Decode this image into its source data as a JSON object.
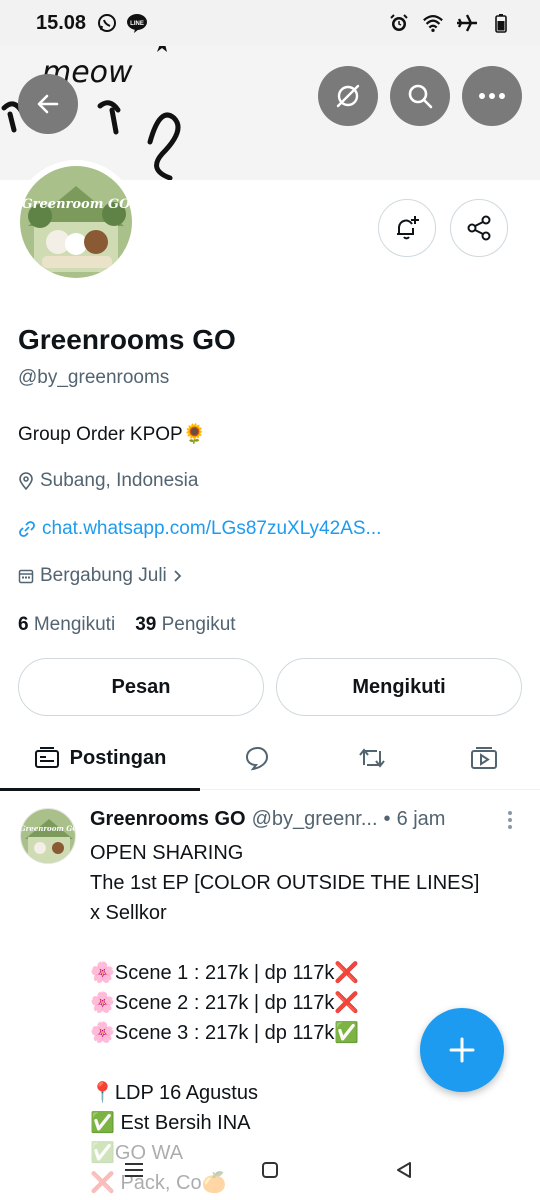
{
  "status_bar": {
    "time": "15.08",
    "left_icons": [
      "whatsapp-icon",
      "line-icon"
    ],
    "right_icons": [
      "alarm-icon",
      "wifi-icon",
      "airplane-icon",
      "battery-icon"
    ]
  },
  "banner": {
    "background": "#f4f4f4",
    "doodle_text": "meow",
    "buttons": [
      "back-arrow-icon",
      "eye-off-icon",
      "search-icon",
      "more-horizontal-icon"
    ]
  },
  "profile": {
    "avatar_text": "Greenroom GO",
    "name": "Greenrooms GO",
    "handle": "@by_greenrooms",
    "bio": "Group Order KPOP🌻",
    "location": "Subang, Indonesia",
    "link": "chat.whatsapp.com/LGs87zuXLy42AS...",
    "joined": "Bergabung Juli",
    "following_count": "6",
    "following_label": "Mengikuti",
    "followers_count": "39",
    "followers_label": "Pengikut",
    "message_button": "Pesan",
    "following_button": "Mengikuti"
  },
  "tabs": [
    {
      "label": "Postingan",
      "icon": "posts-icon",
      "active": true
    },
    {
      "label": "",
      "icon": "reply-bubble-icon"
    },
    {
      "label": "",
      "icon": "repost-icon"
    },
    {
      "label": "",
      "icon": "media-icon"
    }
  ],
  "post": {
    "author": "Greenrooms GO",
    "handle": "@by_greenr...",
    "dot": "•",
    "time": "6 jam",
    "lines": [
      "OPEN SHARING",
      "The 1st EP [COLOR OUTSIDE THE LINES]",
      "x Sellkor",
      "",
      "🌸Scene 1 : 217k | dp 117k❌",
      "🌸Scene 2 : 217k | dp 117k❌",
      "🌸Scene 3 : 217k | dp 117k✅",
      "",
      "📍LDP 16 Agustus",
      "✅ Est Bersih INA",
      "✅GO WA",
      "❌ Pack, Co🍊"
    ]
  },
  "fab": {
    "icon": "plus-icon",
    "color": "#1d9bf0"
  },
  "nav_bar": [
    "recent-apps-icon",
    "home-icon",
    "back-triangle-icon"
  ],
  "colors": {
    "accent": "#1d9bf0",
    "text": "#0f1419",
    "muted": "#536471",
    "border": "#cfd9de"
  }
}
